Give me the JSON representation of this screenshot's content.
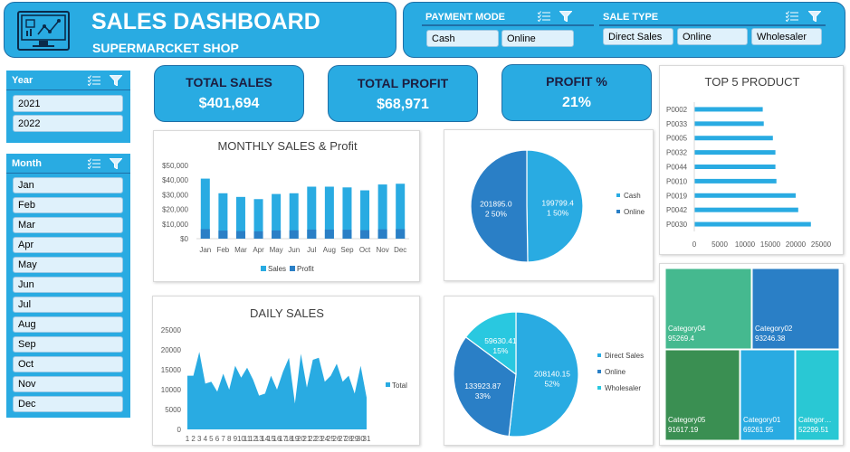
{
  "header": {
    "title": "SALES DASHBOARD",
    "subtitle": "SUPERMARCKET SHOP"
  },
  "colors": {
    "accent": "#29abe2",
    "dark_blue": "#2a7fc6",
    "border": "#1f6fa6"
  },
  "payment_slicer": {
    "label": "PAYMENT MODE",
    "options": [
      "Cash",
      "Online"
    ]
  },
  "sale_type_slicer": {
    "label": "SALE TYPE",
    "options": [
      "Direct Sales",
      "Online",
      "Wholesaler"
    ]
  },
  "year_slicer": {
    "label": "Year",
    "options": [
      "2021",
      "2022"
    ]
  },
  "month_slicer": {
    "label": "Month",
    "options": [
      "Jan",
      "Feb",
      "Mar",
      "Apr",
      "May",
      "Jun",
      "Jul",
      "Aug",
      "Sep",
      "Oct",
      "Nov",
      "Dec"
    ]
  },
  "kpis": [
    {
      "label": "TOTAL SALES",
      "value": "$401,694"
    },
    {
      "label": "TOTAL PROFIT",
      "value": "$68,971"
    },
    {
      "label": "PROFIT %",
      "value": "21%"
    }
  ],
  "icons": {
    "dashboard": "monitor-chart-icon",
    "multiselect": "multiselect-icon",
    "filter": "filter-icon"
  },
  "chart_data": [
    {
      "type": "bar",
      "title": "MONTHLY SALES & Profit",
      "categories": [
        "Jan",
        "Feb",
        "Mar",
        "Apr",
        "May",
        "Jun",
        "Jul",
        "Aug",
        "Sep",
        "Oct",
        "Nov",
        "Dec"
      ],
      "series": [
        {
          "name": "Sales",
          "values": [
            41000,
            31000,
            28500,
            27000,
            30500,
            31000,
            35500,
            35500,
            35000,
            33000,
            37000,
            37500
          ],
          "color": "#29abe2"
        },
        {
          "name": "Profit",
          "values": [
            6500,
            5500,
            5200,
            5000,
            5600,
            5700,
            6200,
            6200,
            6100,
            5800,
            6400,
            6500
          ],
          "color": "#2a7fc6"
        }
      ],
      "stacked": true,
      "ylim": [
        0,
        50000
      ],
      "yticks": [
        "$0",
        "$10,000",
        "$20,000",
        "$30,000",
        "$40,000",
        "$50,000"
      ],
      "legend": "bottom"
    },
    {
      "type": "pie",
      "slices": [
        {
          "name": "Cash",
          "value": 199799.4,
          "percent": "50%",
          "label": "199799.4",
          "pct_label": "1 50%",
          "color": "#29abe2"
        },
        {
          "name": "Online",
          "value": 201895.0,
          "percent": "50%",
          "label": "201895.0",
          "pct_label": "2 50%",
          "color": "#2a7fc6"
        }
      ],
      "legend": "right"
    },
    {
      "type": "bar",
      "orientation": "horizontal",
      "title": "TOP 5 PRODUCT",
      "categories": [
        "P0002",
        "P0033",
        "P0005",
        "P0032",
        "P0044",
        "P0010",
        "P0019",
        "P0042",
        "P0030"
      ],
      "values": [
        13500,
        13700,
        15500,
        16000,
        16000,
        16200,
        20000,
        20500,
        23000
      ],
      "xlim": [
        0,
        25000
      ],
      "xticks": [
        "0",
        "5000",
        "10000",
        "15000",
        "20000",
        "25000"
      ]
    },
    {
      "type": "area",
      "title": "DAILY SALES",
      "x": [
        1,
        2,
        3,
        4,
        5,
        6,
        7,
        8,
        9,
        10,
        11,
        12,
        13,
        14,
        15,
        16,
        17,
        18,
        19,
        20,
        21,
        22,
        23,
        24,
        25,
        26,
        27,
        28,
        29,
        30,
        31
      ],
      "series": [
        {
          "name": "Total",
          "values": [
            13500,
            13500,
            19500,
            11500,
            12000,
            9500,
            14000,
            10000,
            16000,
            13000,
            15500,
            12500,
            8500,
            9000,
            13500,
            10000,
            14500,
            18000,
            6500,
            19000,
            10500,
            17500,
            18000,
            12000,
            13500,
            16500,
            12000,
            13500,
            9000,
            16000,
            8000
          ],
          "color": "#29abe2"
        }
      ],
      "ylim": [
        0,
        25000
      ],
      "yticks": [
        "0",
        "5000",
        "10000",
        "15000",
        "20000",
        "25000"
      ],
      "legend": "right"
    },
    {
      "type": "pie",
      "slices": [
        {
          "name": "Direct Sales",
          "value": 208140.15,
          "percent": "52%",
          "label": "208140.15",
          "pct_label": "52%",
          "color": "#29abe2"
        },
        {
          "name": "Online",
          "value": 133923.87,
          "percent": "33%",
          "label": "133923.87",
          "pct_label": "33%",
          "color": "#2a7fc6"
        },
        {
          "name": "Wholesaler",
          "value": 59630.41,
          "percent": "15%",
          "label": "59630.41",
          "pct_label": "15%",
          "color": "#29c8e0"
        }
      ],
      "legend": "right"
    },
    {
      "type": "heatmap",
      "subtype": "treemap",
      "items": [
        {
          "name": "Category04",
          "value": "95269.4",
          "color": "#45b98f"
        },
        {
          "name": "Category02",
          "value": "93246.38",
          "color": "#2a7fc6"
        },
        {
          "name": "Category05",
          "value": "91617.19",
          "color": "#3a8f52"
        },
        {
          "name": "Category01",
          "value": "69261.95",
          "color": "#29abe2"
        },
        {
          "name": "Categor…",
          "value": "52299.51",
          "color": "#29c8d4"
        }
      ]
    }
  ]
}
